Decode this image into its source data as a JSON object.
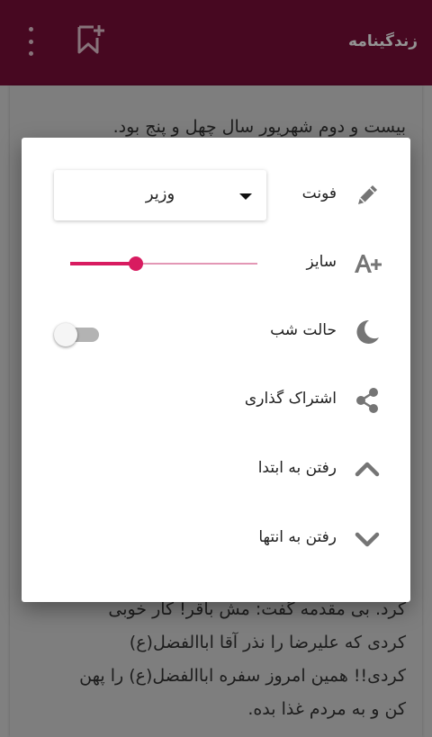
{
  "appbar": {
    "title": "زندگینامه",
    "icons": [
      "more-vert-icon",
      "bookmark-add-icon"
    ]
  },
  "reader": {
    "paragraph_top": "بیست و دوم شهریور سال چهل و پنج بود.",
    "paragraph_bottom": [
      "کرد. بی مقدمه گفت: مش باقر! کار خوبی",
      "کردی که علیرضا را نذر آقا اباالفضل(ع)",
      "کردی!! همین امروز سفره اباالفضل(ع) را پهن",
      "کن و به مردم غذا بده."
    ]
  },
  "settings": {
    "font": {
      "label": "فونت",
      "selected": "وزیر",
      "icon": "pencil-icon"
    },
    "size": {
      "label": "سایز",
      "value_fraction": 0.35,
      "icon": "font-size-increase-icon"
    },
    "night_mode": {
      "label": "حالت شب",
      "enabled": false,
      "icon": "moon-stars-icon"
    },
    "share": {
      "label": "اشتراک گذاری",
      "icon": "share-icon"
    },
    "go_top": {
      "label": "رفتن به ابتدا",
      "icon": "chevron-up-icon"
    },
    "go_end": {
      "label": "رفتن به انتها",
      "icon": "chevron-down-icon"
    }
  },
  "colors": {
    "appbar": "#7a0e3a",
    "accent": "#d81b60",
    "icon_gray": "#757575"
  }
}
